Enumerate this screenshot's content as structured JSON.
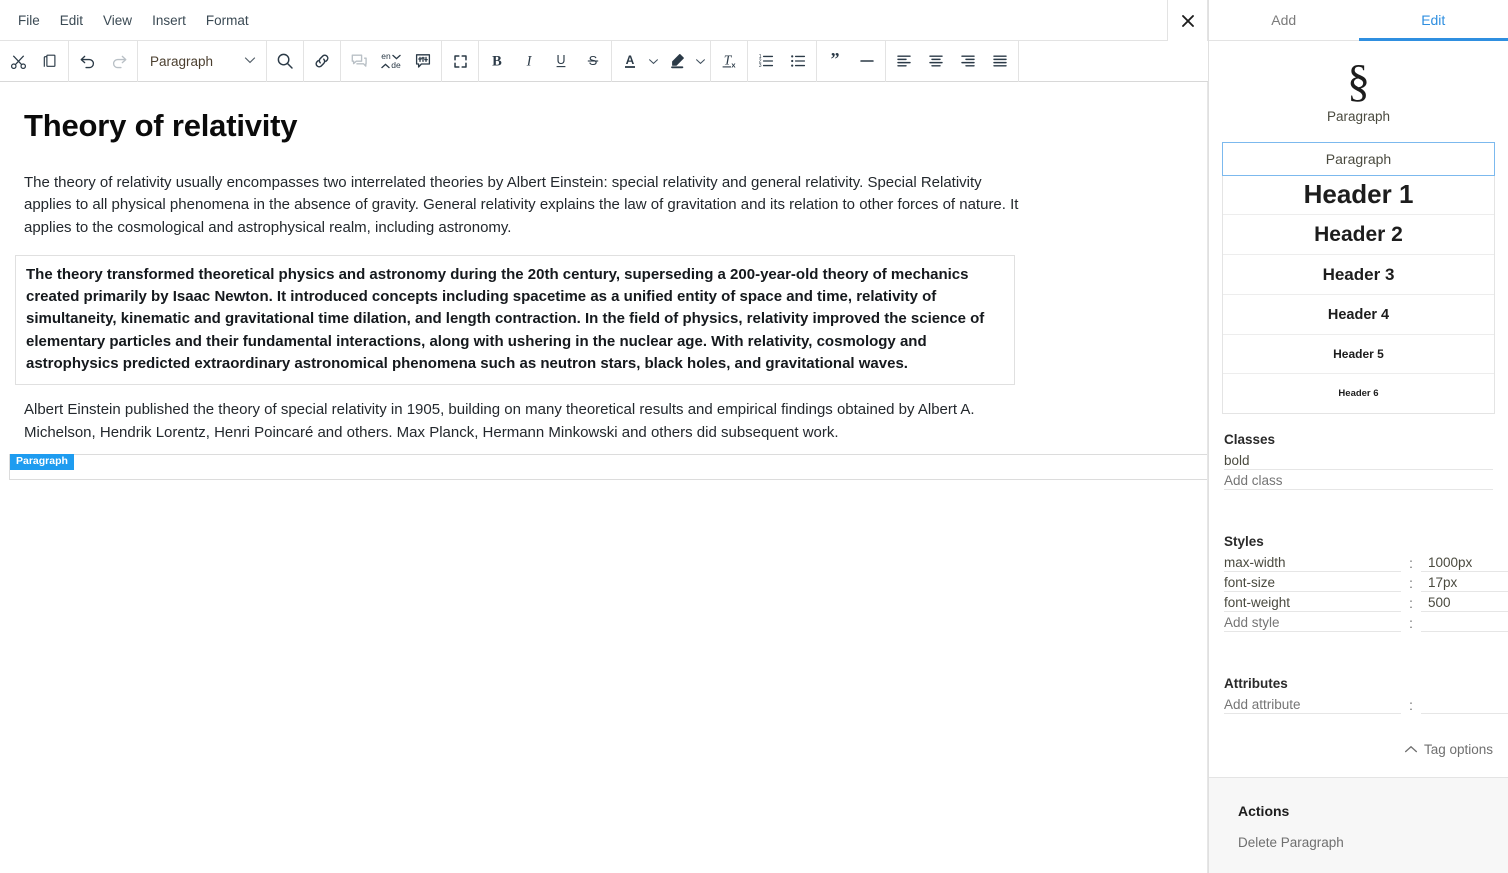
{
  "menubar": {
    "items": [
      "File",
      "Edit",
      "View",
      "Insert",
      "Format"
    ]
  },
  "close_button": {
    "label": "×",
    "name": "close-icon"
  },
  "toolbar": {
    "cut": "Cut",
    "copy": "Copy",
    "undo": "Undo",
    "redo": "Redo",
    "block_select": {
      "value": "Paragraph"
    },
    "search": "Search",
    "link": "Link",
    "comment": "Comment",
    "translate": {
      "from": "en",
      "to": "de"
    },
    "speech_settings": "Speech settings",
    "fullscreen": "Fullscreen",
    "bold": "B",
    "italic": "I",
    "underline": "U",
    "strikethrough": "S",
    "text_color": "A",
    "highlight_color": "Highlight",
    "clear_format": "Clear formatting",
    "ordered_list": "Ordered list",
    "unordered_list": "Unordered list",
    "blockquote": "Blockquote",
    "horizontal_rule": "Horizontal rule",
    "align_left": "Align left",
    "align_center": "Align center",
    "align_right": "Align right",
    "align_justify": "Justify"
  },
  "document": {
    "title": "Theory of relativity",
    "paragraphs": [
      {
        "text": "The theory of relativity usually encompasses two interrelated theories by Albert Einstein: special relativity and general relativity. Special Relativity applies to all physical phenomena in the absence of gravity. General relativity explains the law of gravitation and its relation to other forces of nature. It applies to the cosmological and astrophysical realm, including astronomy.",
        "boxed": false
      },
      {
        "text": "The theory transformed theoretical physics and astronomy during the 20th century, superseding a 200-year-old theory of mechanics created primarily by Isaac Newton. It introduced concepts including spacetime as a unified entity of space and time, relativity of simultaneity, kinematic and gravitational time dilation, and length contraction. In the field of physics, relativity improved the science of elementary particles and their fundamental interactions, along with ushering in the nuclear age. With relativity, cosmology and astrophysics predicted extraordinary astronomical phenomena such as neutron stars, black holes, and gravitational waves.",
        "boxed": true
      },
      {
        "text": "Albert Einstein published the theory of special relativity in 1905, building on many theoretical results and empirical findings obtained by Albert A. Michelson, Hendrik Lorentz, Henri Poincaré and others. Max Planck, Hermann Minkowski and others did subsequent work.",
        "boxed": false
      }
    ],
    "selected_block_badge": "Paragraph"
  },
  "panel": {
    "tabs": [
      {
        "label": "Add",
        "active": false
      },
      {
        "label": "Edit",
        "active": true
      }
    ],
    "tag": {
      "glyph": "§",
      "name": "Paragraph"
    },
    "block_types": [
      {
        "label": "Paragraph",
        "selected": true
      },
      {
        "label": "Header 1",
        "selected": false
      },
      {
        "label": "Header 2",
        "selected": false
      },
      {
        "label": "Header 3",
        "selected": false
      },
      {
        "label": "Header 4",
        "selected": false
      },
      {
        "label": "Header 5",
        "selected": false
      },
      {
        "label": "Header 6",
        "selected": false
      }
    ],
    "classes": {
      "title": "Classes",
      "values": [
        "bold"
      ],
      "add_placeholder": "Add class"
    },
    "styles": {
      "title": "Styles",
      "rows": [
        {
          "prop": "max-width",
          "value": "1000px"
        },
        {
          "prop": "font-size",
          "value": "17px"
        },
        {
          "prop": "font-weight",
          "value": "500"
        }
      ],
      "add_prop_placeholder": "Add style",
      "add_value_placeholder": "",
      "separator": ":"
    },
    "attributes": {
      "title": "Attributes",
      "add_prop_placeholder": "Add attribute",
      "add_value_placeholder": "",
      "separator": ":"
    },
    "tag_options": {
      "label": "Tag options",
      "chevron": "∧"
    },
    "actions": {
      "title": "Actions",
      "items": [
        "Delete Paragraph"
      ]
    }
  },
  "colors": {
    "accent": "#2f8fe0",
    "badge": "#1e9cf0",
    "panel_bg": "#ffffff",
    "actions_bg": "#f7f7f7",
    "text": "#23282d"
  }
}
